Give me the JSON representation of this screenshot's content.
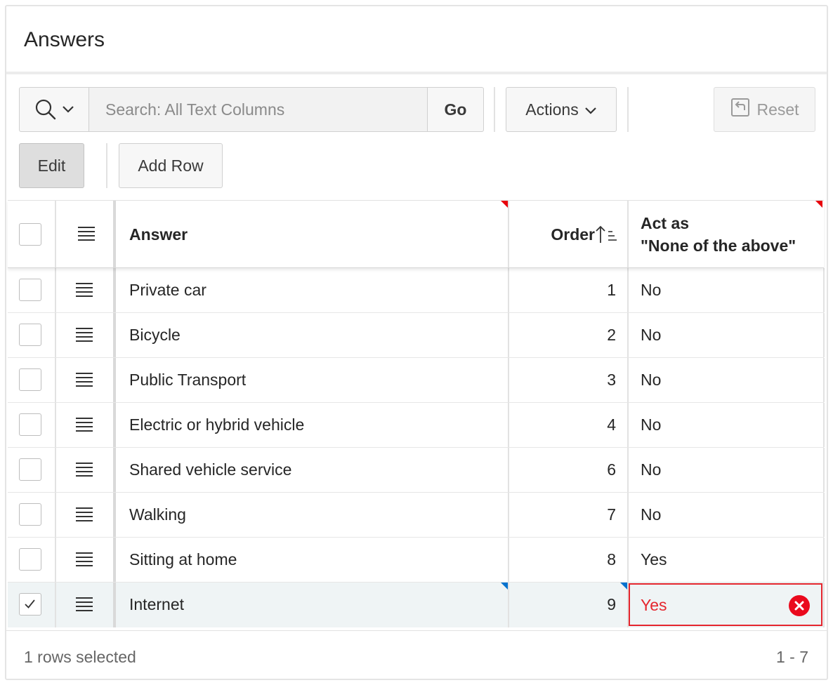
{
  "region": {
    "title": "Answers"
  },
  "toolbar": {
    "search_placeholder": "Search: All Text Columns",
    "go_label": "Go",
    "actions_label": "Actions",
    "reset_label": "Reset",
    "edit_label": "Edit",
    "add_row_label": "Add Row"
  },
  "grid": {
    "columns": {
      "answer": "Answer",
      "order": "Order",
      "none_line1": "Act as",
      "none_line2": "\"None of the above\""
    },
    "rows": [
      {
        "answer": "Private car",
        "order": "1",
        "none": "No",
        "checked": false
      },
      {
        "answer": "Bicycle",
        "order": "2",
        "none": "No",
        "checked": false
      },
      {
        "answer": "Public Transport",
        "order": "3",
        "none": "No",
        "checked": false
      },
      {
        "answer": "Electric or hybrid vehicle",
        "order": "4",
        "none": "No",
        "checked": false
      },
      {
        "answer": "Shared vehicle service",
        "order": "6",
        "none": "No",
        "checked": false
      },
      {
        "answer": "Walking",
        "order": "7",
        "none": "No",
        "checked": false
      },
      {
        "answer": "Sitting at home",
        "order": "8",
        "none": "Yes",
        "checked": false
      },
      {
        "answer": "Internet",
        "order": "9",
        "none": "Yes",
        "checked": true
      }
    ]
  },
  "footer": {
    "selection": "1 rows selected",
    "range": "1 - 7"
  },
  "colors": {
    "error": "#e5262e",
    "selected_row": "#eff4f5",
    "changed_marker": "#0572ce",
    "required_marker": "#e8000b"
  }
}
